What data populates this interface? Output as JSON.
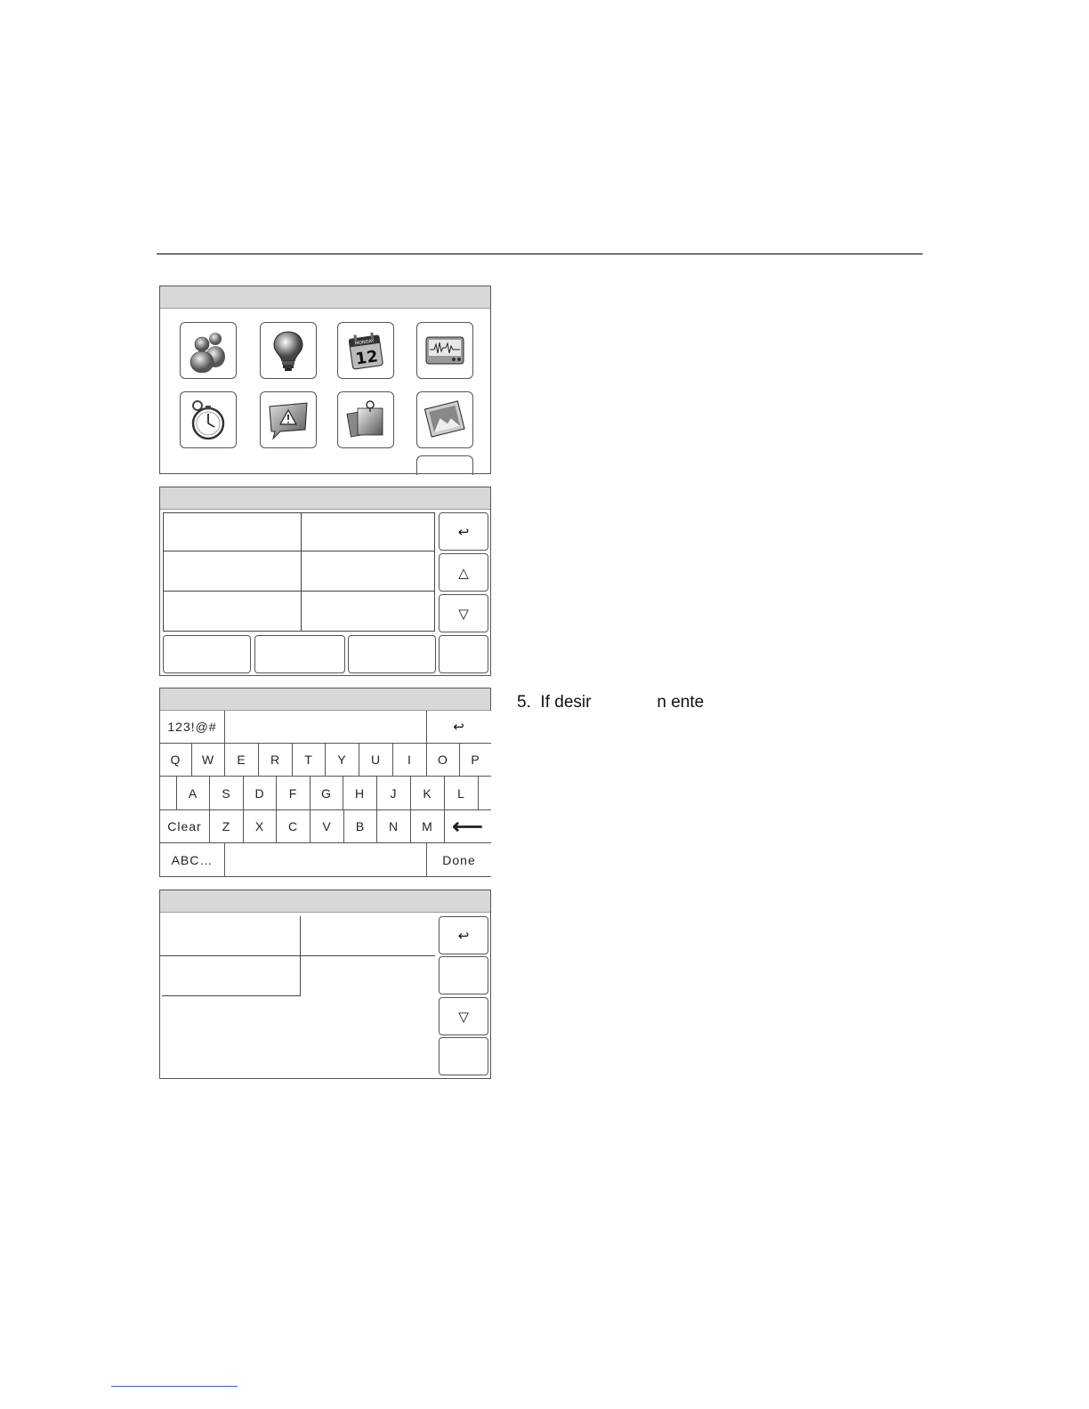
{
  "step": {
    "number": "5.",
    "text": "If desir              n ente"
  },
  "icons": [
    "users-icon",
    "lightbulb-icon",
    "calendar-icon",
    "waveform-monitor-icon",
    "stopwatch-icon",
    "alert-message-icon",
    "notes-icon",
    "picture-icon"
  ],
  "calendar_day": "12",
  "calendar_month": "MONDAY",
  "glyphs": {
    "back": "↩",
    "up": "△",
    "down": "▽",
    "arrow_left": "⟵"
  },
  "keyboard": {
    "symbols_label": "123!@#",
    "row1": [
      "Q",
      "W",
      "E",
      "R",
      "T",
      "Y",
      "U",
      "I",
      "O",
      "P"
    ],
    "row2": [
      "A",
      "S",
      "D",
      "F",
      "G",
      "H",
      "J",
      "K",
      "L"
    ],
    "row3": [
      "Z",
      "X",
      "C",
      "V",
      "B",
      "N",
      "M"
    ],
    "clear_label": "Clear",
    "abc_label": "ABC…",
    "done_label": "Done"
  },
  "colors": {
    "titlebar": "#d8d8d8",
    "border": "#555555",
    "link_underline": "#3a5bd9"
  }
}
